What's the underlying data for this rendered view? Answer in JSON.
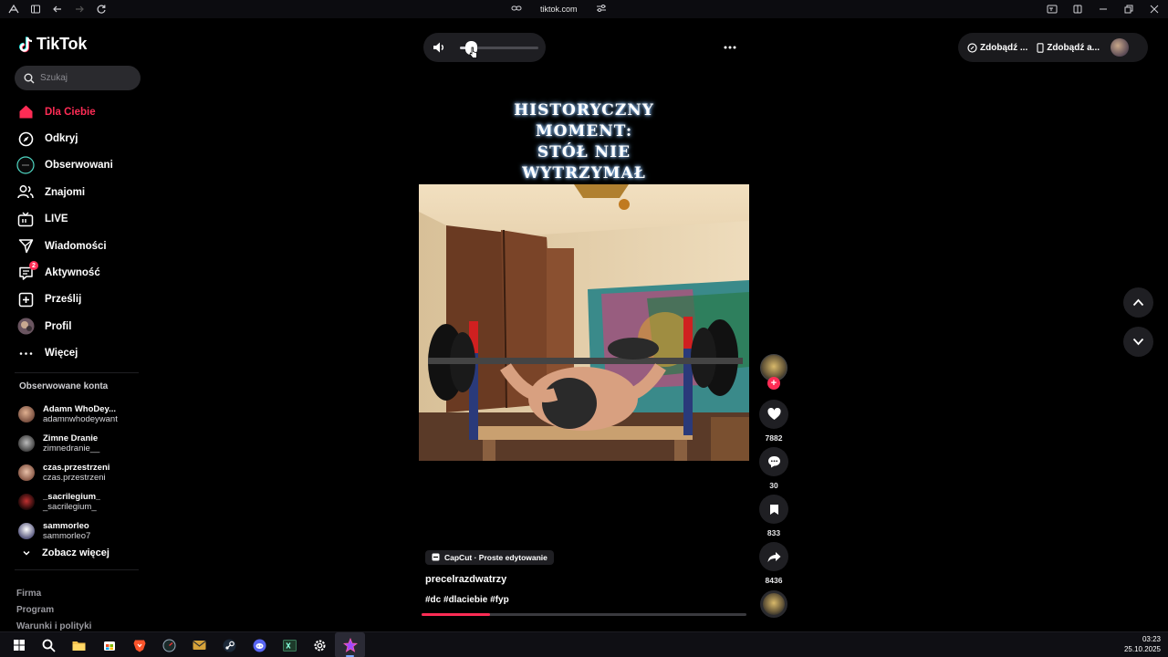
{
  "browser": {
    "url": "tiktok.com"
  },
  "brand": {
    "name": "TikTok",
    "accent": "#fe2c55"
  },
  "search": {
    "placeholder": "Szukaj"
  },
  "nav": {
    "items": [
      {
        "label": "Dla Ciebie",
        "icon": "home-icon",
        "active": true
      },
      {
        "label": "Odkryj",
        "icon": "compass-icon"
      },
      {
        "label": "Obserwowani",
        "icon": "following-icon"
      },
      {
        "label": "Znajomi",
        "icon": "friends-icon"
      },
      {
        "label": "LIVE",
        "icon": "live-icon"
      },
      {
        "label": "Wiadomości",
        "icon": "send-icon"
      },
      {
        "label": "Aktywność",
        "icon": "activity-icon",
        "badge": "2"
      },
      {
        "label": "Prześlij",
        "icon": "upload-icon"
      },
      {
        "label": "Profil",
        "icon": "profile-avatar"
      },
      {
        "label": "Więcej",
        "icon": "more-icon"
      }
    ]
  },
  "following": {
    "title": "Obserwowane konta",
    "accounts": [
      {
        "name": "Adamn WhoDey...",
        "handle": "adamnwhodeywant",
        "color": "#c89070"
      },
      {
        "name": "Zimne Dranie",
        "handle": "zimnedranie__",
        "color": "#8a8a8a"
      },
      {
        "name": "czas.przestrzeni",
        "handle": "czas.przestrzeni",
        "color": "#b0806a"
      },
      {
        "name": "_sacrilegium_",
        "handle": "_sacrilegium_",
        "color": "#8a2a2a"
      },
      {
        "name": "sammorleo",
        "handle": "sammorleo7",
        "color": "#d0d0e0"
      }
    ],
    "see_more": "Zobacz więcej"
  },
  "footer": {
    "links": [
      "Firma",
      "Program",
      "Warunki i polityki"
    ]
  },
  "player": {
    "volume_level": 0.14
  },
  "topbar": {
    "coins_label": "Zdobądź ...",
    "app_label": "Zdobądź a..."
  },
  "video": {
    "overlay_title_lines": [
      "HISTORYCZNY",
      "MOMENT:",
      "STÓŁ NIE",
      "WYTRZYMAŁ"
    ],
    "capcut_label": "CapCut · Proste edytowanie",
    "author": "precelrazdwatrzy",
    "hashtags": "#dc #dlaciebie #fyp",
    "progress": 0.21
  },
  "actions": {
    "likes": "7882",
    "comments": "30",
    "saves": "833",
    "shares": "8436"
  },
  "taskbar": {
    "time": "03:23",
    "date": "25.10.2025"
  }
}
